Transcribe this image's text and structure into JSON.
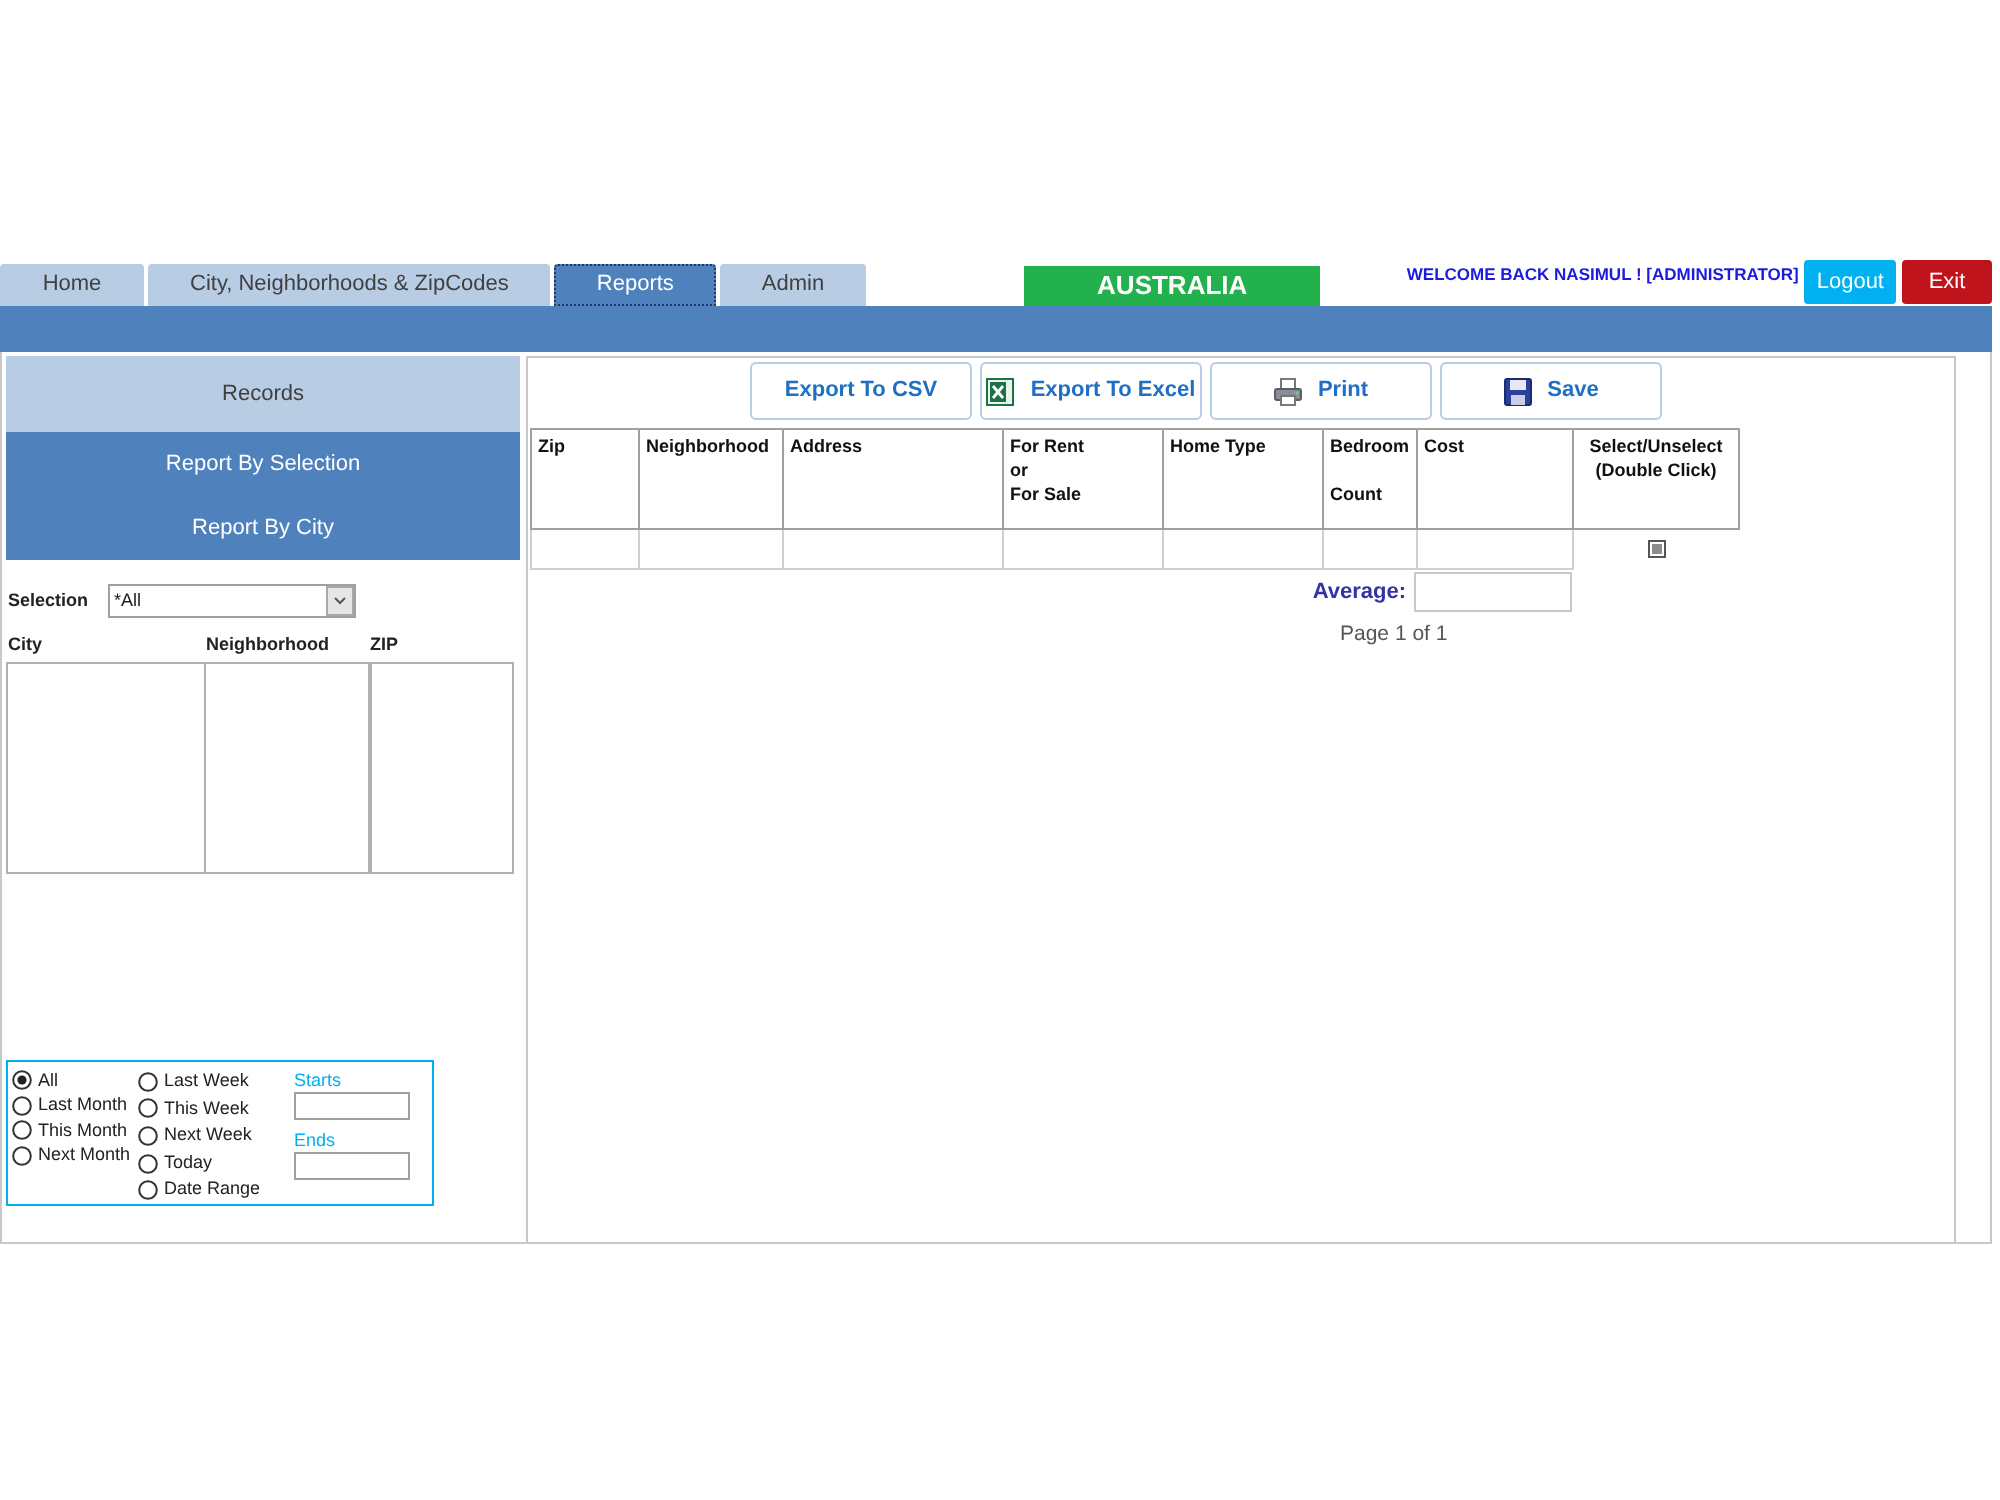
{
  "tabs": [
    {
      "label": "Home",
      "selected": false
    },
    {
      "label": "City, Neighborhoods & ZipCodes",
      "selected": false
    },
    {
      "label": "Reports",
      "selected": true
    },
    {
      "label": "Admin",
      "selected": false
    }
  ],
  "header": {
    "region": "AUSTRALIA",
    "welcome": "WELCOME BACK NASIMUL ! [ADMINISTRATOR]",
    "buttons": [
      {
        "label": "Logout",
        "kind": "logout"
      },
      {
        "label": "Exit",
        "kind": "exit"
      }
    ]
  },
  "sidebar": {
    "items": [
      {
        "label": "Records",
        "kind": "title"
      },
      {
        "label": "Report By Selection",
        "kind": "link"
      },
      {
        "label": "Report By City",
        "kind": "link"
      }
    ],
    "selection": {
      "label": "Selection",
      "value": "*All"
    },
    "list_columns": [
      "City",
      "Neighborhood",
      "ZIP"
    ],
    "date_filter": {
      "option_columns": [
        {
          "options": [
            {
              "label": "All",
              "selected": true
            },
            {
              "label": "Last Month",
              "selected": false
            },
            {
              "label": "This Month",
              "selected": false
            },
            {
              "label": "Next Month",
              "selected": false
            }
          ]
        },
        {
          "options": [
            {
              "label": "Last Week",
              "selected": false
            },
            {
              "label": "This Week",
              "selected": false
            },
            {
              "label": "Next Week",
              "selected": false
            },
            {
              "label": "Today",
              "selected": false
            },
            {
              "label": "Date Range",
              "selected": false
            }
          ]
        }
      ],
      "fields": [
        {
          "label": "Starts"
        },
        {
          "label": "Ends"
        }
      ]
    }
  },
  "toolbar": [
    {
      "label": "Export To CSV",
      "kind": "csv"
    },
    {
      "label": "Export To Excel",
      "kind": "excel"
    },
    {
      "label": "Print",
      "kind": "print"
    },
    {
      "label": "Save",
      "kind": "save"
    }
  ],
  "table": {
    "columns": [
      "Zip",
      "Neighborhood",
      "Address",
      "For Rent\nor\nFor Sale",
      "Home Type",
      "Bedroom\n\nCount",
      "Cost",
      "Select/Unselect\n(Double Click)"
    ],
    "new_row": {
      "select_disabled": true
    }
  },
  "summary": {
    "average_label": "Average:",
    "pager": "Page 1 of 1"
  }
}
